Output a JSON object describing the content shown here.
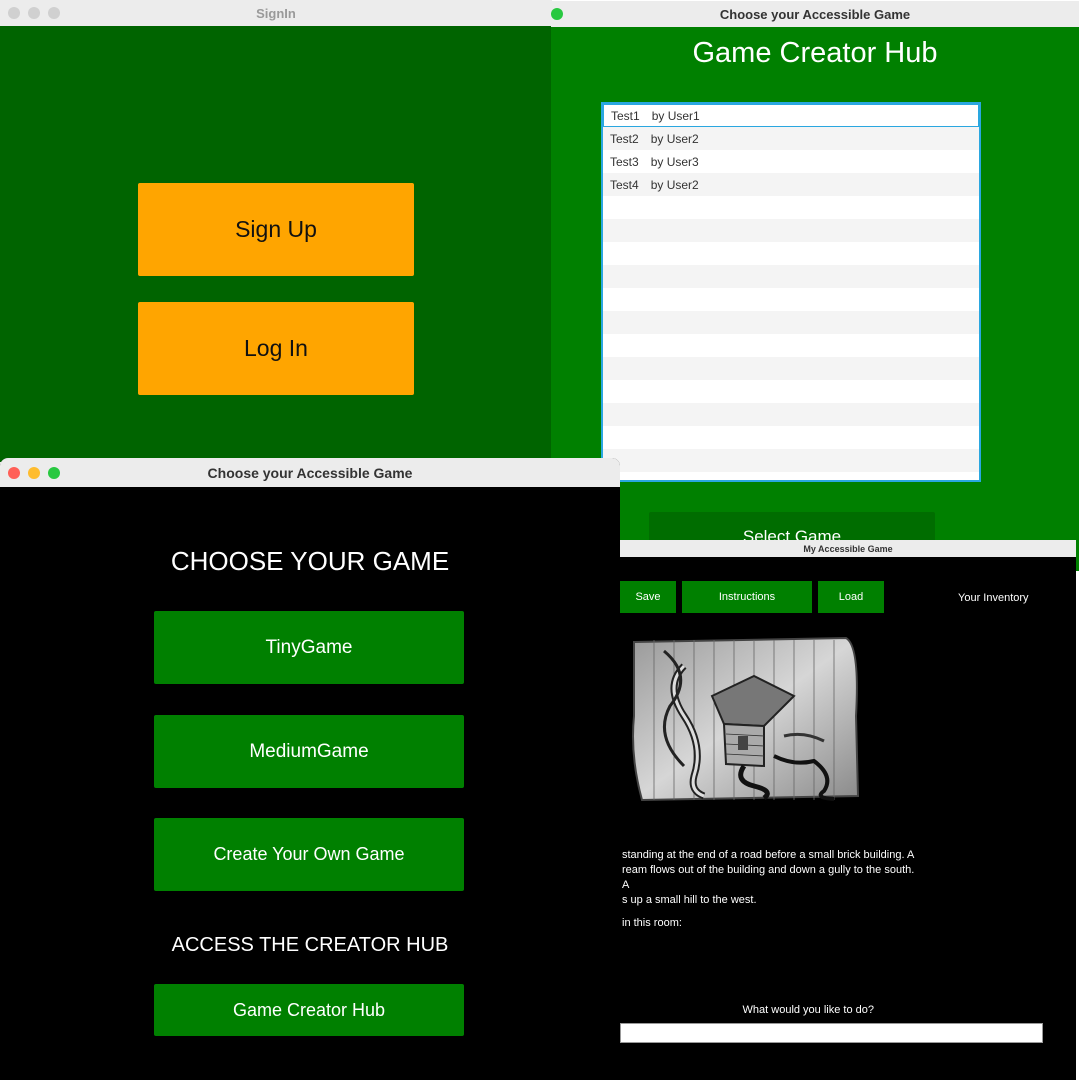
{
  "signin_window": {
    "title": "SignIn",
    "signup_label": "Sign Up",
    "login_label": "Log In"
  },
  "hub_window": {
    "title": "Choose your Accessible Game",
    "heading": "Game Creator Hub",
    "games": [
      {
        "name": "Test1",
        "author": "by User1"
      },
      {
        "name": "Test2",
        "author": "by User2"
      },
      {
        "name": "Test3",
        "author": "by User3"
      },
      {
        "name": "Test4",
        "author": "by User2"
      }
    ],
    "select_label": "Select Game"
  },
  "choose_window": {
    "title": "Choose your Accessible Game",
    "heading": "CHOOSE YOUR GAME",
    "games": [
      "TinyGame",
      "MediumGame",
      "Create Your Own Game"
    ],
    "hub_heading": "ACCESS THE CREATOR HUB",
    "hub_button_label": "Game Creator Hub"
  },
  "game_window": {
    "title": "My Accessible Game",
    "toolbar": {
      "save_label": "Save",
      "instructions_label": "Instructions",
      "load_label": "Load",
      "inventory_label": "Your Inventory"
    },
    "description": "standing at the end of a road before a small brick building.  A\nream flows out of the building and down a gully to the south.  A\ns up a small hill to the west.",
    "items_label": "in this room:",
    "prompt": "What would you like to do?",
    "command_value": ""
  },
  "colors": {
    "dark_green": "#006400",
    "green": "#008000",
    "orange": "#ffa500",
    "black": "#000000",
    "list_border": "#2aa7e0"
  }
}
